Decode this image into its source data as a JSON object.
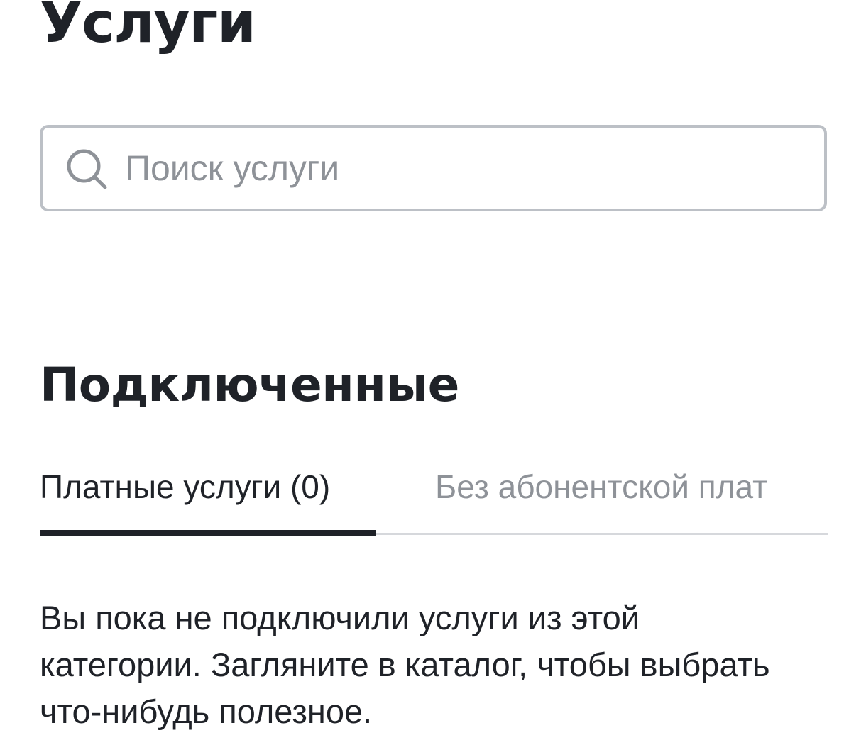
{
  "page": {
    "title": "Услуги"
  },
  "search": {
    "placeholder": "Поиск услуги",
    "value": "",
    "icon": "search-icon"
  },
  "connected": {
    "title": "Подключенные",
    "tabs": [
      {
        "label": "Платные услуги (0)",
        "active": true
      },
      {
        "label": "Без абонентской плат",
        "active": false
      }
    ],
    "empty_message": "Вы пока не подключили услуги из этой категории. Загляните в каталог, чтобы выбрать что-нибудь полезное."
  },
  "colors": {
    "text": "#1f2228",
    "muted": "#8e9298",
    "border": "#bcc0c6",
    "divider": "#d6d8dc"
  }
}
